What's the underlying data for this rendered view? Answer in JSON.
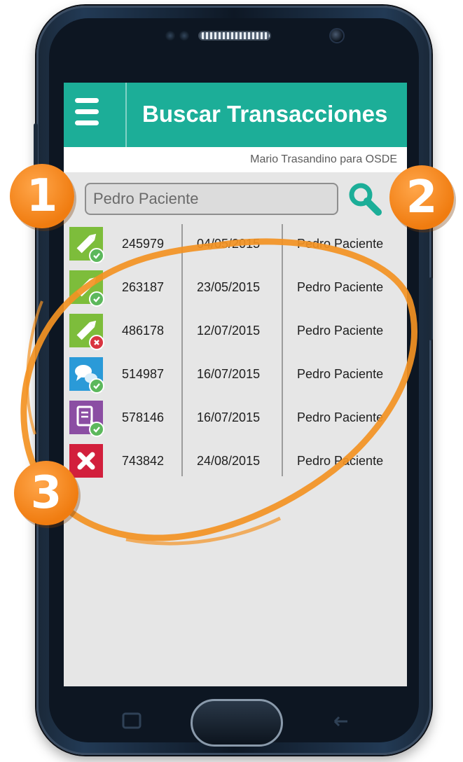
{
  "app_bar": {
    "menu_icon": "hamburger-menu-icon",
    "title": "Buscar Transacciones",
    "color": "#1cae98"
  },
  "user_line": "Mario Trasandino para OSDE",
  "search": {
    "value": "Pedro Paciente",
    "button_icon": "magnifier-icon",
    "icon_color": "#1cae98"
  },
  "transactions": [
    {
      "id": "245979",
      "date": "04/05/2015",
      "patient": "Pedro Paciente",
      "type_icon": "pencil-icon",
      "tile_color": "#7dbd3b",
      "status": "approved"
    },
    {
      "id": "263187",
      "date": "23/05/2015",
      "patient": "Pedro Paciente",
      "type_icon": "pencil-icon",
      "tile_color": "#7dbd3b",
      "status": "approved"
    },
    {
      "id": "486178",
      "date": "12/07/2015",
      "patient": "Pedro Paciente",
      "type_icon": "pencil-icon",
      "tile_color": "#7dbd3b",
      "status": "rejected"
    },
    {
      "id": "514987",
      "date": "16/07/2015",
      "patient": "Pedro Paciente",
      "type_icon": "chat-bubbles-icon",
      "tile_color": "#2a9ad8",
      "status": "approved"
    },
    {
      "id": "578146",
      "date": "16/07/2015",
      "patient": "Pedro Paciente",
      "type_icon": "document-icon",
      "tile_color": "#8b4ea3",
      "status": "approved"
    },
    {
      "id": "743842",
      "date": "24/08/2015",
      "patient": "Pedro Paciente",
      "type_icon": "close-x-icon",
      "tile_color": "#d21f3c",
      "status": "cancelled"
    }
  ],
  "callouts": [
    {
      "number": "1",
      "color": "#f39323"
    },
    {
      "number": "2",
      "color": "#f39323"
    },
    {
      "number": "3",
      "color": "#f39323"
    }
  ],
  "status_colors": {
    "approved": "#5cb85c",
    "rejected": "#d9343f"
  }
}
